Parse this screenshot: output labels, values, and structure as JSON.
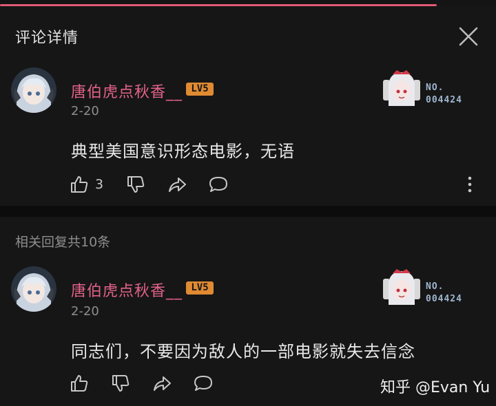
{
  "header": {
    "title": "评论详情"
  },
  "progress": 0.88,
  "main_comment": {
    "username": "唐伯虎点秋香__",
    "level": "LV5",
    "date": "2-20",
    "content": "典型美国意识形态电影，无语",
    "like_count": "3",
    "fan_card": {
      "label": "NO.",
      "number": "004424"
    }
  },
  "replies": {
    "count_label": "相关回复共10条"
  },
  "reply_comment": {
    "username": "唐伯虎点秋香__",
    "level": "LV5",
    "date": "2-20",
    "content": "同志们，不要因为敌人的一部电影就失去信念",
    "fan_card": {
      "label": "NO.",
      "number": "004424"
    }
  },
  "watermark": "知乎 @Evan Yu",
  "colors": {
    "accent": "#e05a74",
    "username": "#e3628a",
    "level_badge": "#e08a33",
    "background": "#161616"
  }
}
